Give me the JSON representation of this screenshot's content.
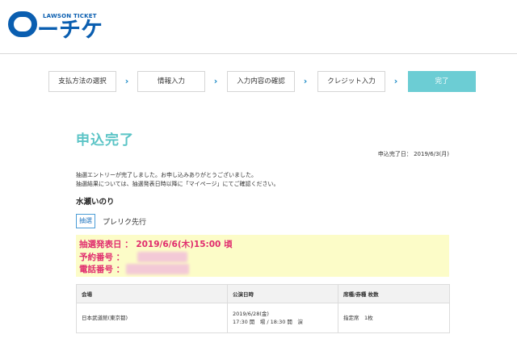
{
  "logo": {
    "brand_sub": "LAWSON TICKET",
    "brand_main": "ーチケ"
  },
  "steps": [
    {
      "label": "支払方法の選択"
    },
    {
      "label": "情報入力"
    },
    {
      "label": "入力内容の確認"
    },
    {
      "label": "クレジット入力"
    },
    {
      "label": "完了",
      "active": true
    }
  ],
  "page": {
    "title": "申込完了",
    "apply_date_label": "申込完了日：",
    "apply_date": "2019/6/3(月)",
    "messages": [
      "抽選エントリーが完了しました。お申し込みありがとうございました。",
      "抽選結果については、抽選発表日時以降に「マイページ」にてご確認ください。"
    ]
  },
  "event": {
    "artist": "水瀬いのり",
    "type_badge": "抽選",
    "sale_name": "プレリク先行"
  },
  "result": {
    "announce_label": "抽選発表日 ：",
    "announce_value": "2019/6/6(木)15:00 頃",
    "reservation_label": "予約番号 ：",
    "phone_label": "電話番号 ："
  },
  "table": {
    "headers": [
      "会場",
      "公演日時",
      "席種/券種 枚数"
    ],
    "rows": [
      {
        "venue": "日本武道館(東京都)",
        "date": "2019/6/28(金)",
        "time": "17:30 開　場 / 18:30 開　演",
        "seat": "指定席　1枚"
      }
    ]
  }
}
